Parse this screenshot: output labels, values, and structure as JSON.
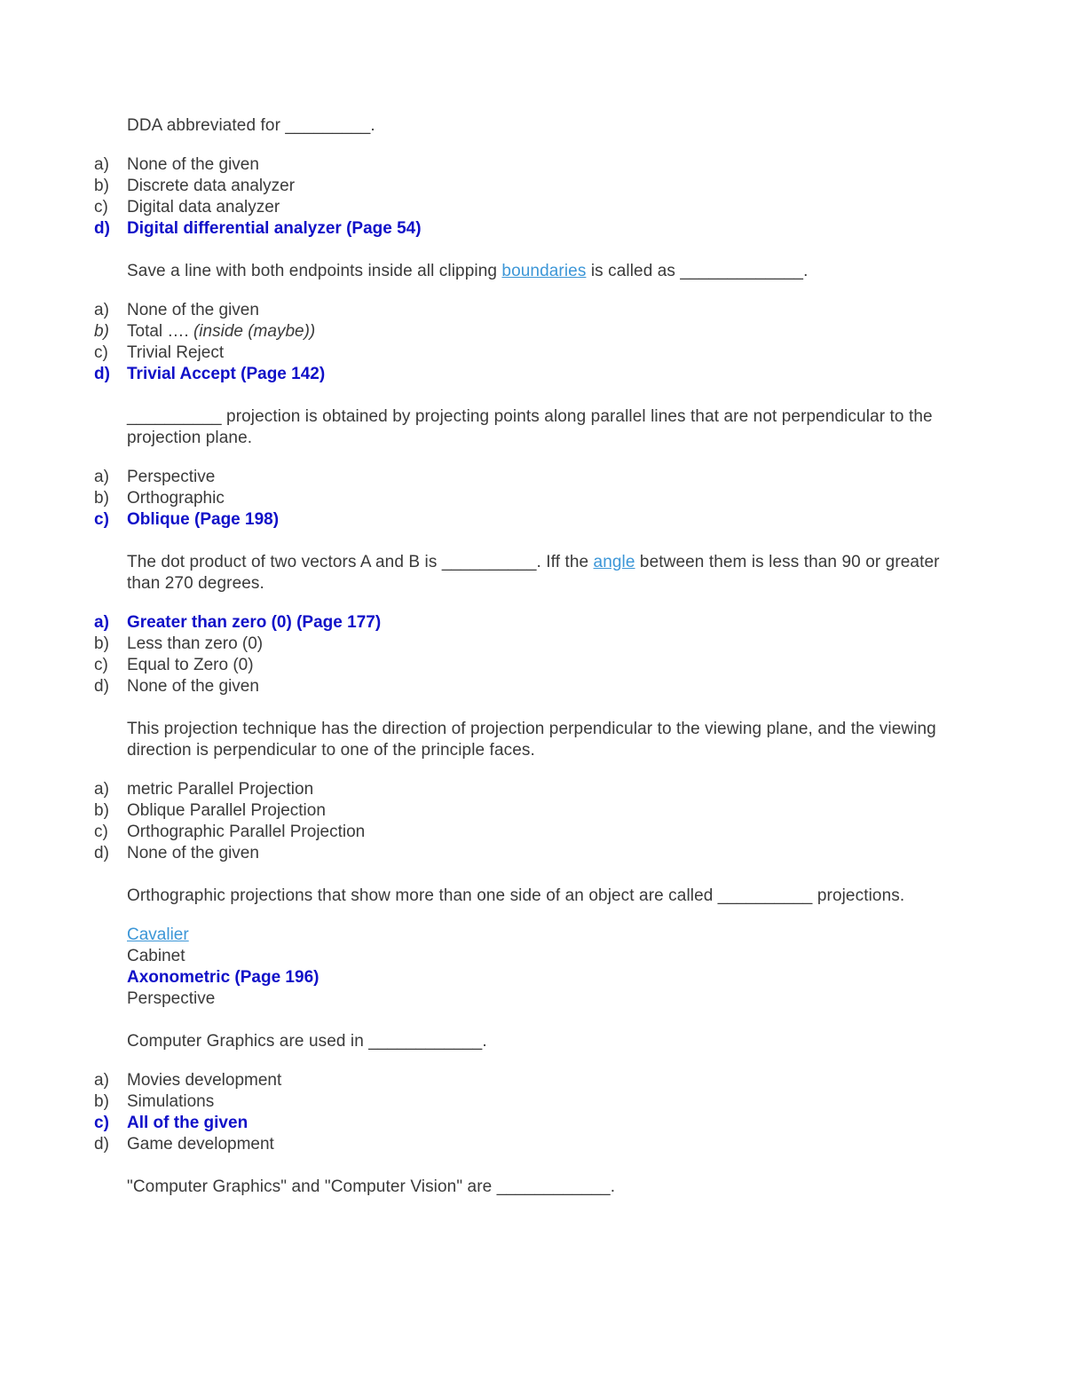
{
  "document": {
    "title": "Computer Graphics MCQs",
    "colors": {
      "body_text": "#3a3a3a",
      "correct_answer": "#1010c8",
      "hyperlink": "#3c96d7",
      "background": "#ffffff"
    }
  },
  "questions": [
    {
      "id": "q1",
      "stem_parts": [
        {
          "type": "text",
          "value": "DDA abbreviated for "
        },
        {
          "type": "blank",
          "value": "_________"
        },
        {
          "type": "text",
          "value": "."
        }
      ],
      "stem_plain": "DDA abbreviated for _________.",
      "labeled": true,
      "options": [
        {
          "label": "a)",
          "text": "None of the given",
          "correct": false,
          "italic": false
        },
        {
          "label": "b)",
          "text": "Discrete data analyzer",
          "correct": false,
          "italic": false
        },
        {
          "label": "c)",
          "text": "Digital data analyzer",
          "correct": false,
          "italic": false
        },
        {
          "label": "d)",
          "text": "Digital differential analyzer (Page 54)",
          "correct": true,
          "italic": false
        }
      ]
    },
    {
      "id": "q2",
      "stem_parts": [
        {
          "type": "text",
          "value": "Save a line with both endpoints inside all clipping "
        },
        {
          "type": "link",
          "value": "boundaries"
        },
        {
          "type": "text",
          "value": " is called as "
        },
        {
          "type": "blank",
          "value": "_____________"
        },
        {
          "type": "text",
          "value": "."
        }
      ],
      "stem_plain": "Save a line with both endpoints inside all clipping boundaries is called as _____________.",
      "labeled": true,
      "options": [
        {
          "label": "a)",
          "text": "None of the given",
          "correct": false,
          "italic": false
        },
        {
          "label": "b)",
          "text": "Total …. (inside (maybe))",
          "correct": false,
          "italic": true,
          "plain_prefix": "Total …. ",
          "italic_suffix": "(inside (maybe))"
        },
        {
          "label": "c)",
          "text": "Trivial Reject",
          "correct": false,
          "italic": false
        },
        {
          "label": "d)",
          "text": "Trivial Accept (Page 142)",
          "correct": true,
          "italic": false
        }
      ]
    },
    {
      "id": "q3",
      "stem_parts": [
        {
          "type": "blank",
          "value": "__________"
        },
        {
          "type": "text",
          "value": " projection is obtained by projecting points along parallel lines that are not perpendicular to the projection plane."
        }
      ],
      "stem_plain": "__________ projection is obtained by projecting points along parallel lines that are not perpendicular to the projection plane.",
      "labeled": true,
      "options": [
        {
          "label": "a)",
          "text": "Perspective",
          "correct": false,
          "italic": false
        },
        {
          "label": "b)",
          "text": "Orthographic",
          "correct": false,
          "italic": false
        },
        {
          "label": "c)",
          "text": "Oblique (Page 198)",
          "correct": true,
          "italic": false
        }
      ]
    },
    {
      "id": "q4",
      "stem_parts": [
        {
          "type": "text",
          "value": "The dot product of two vectors A and B is "
        },
        {
          "type": "blank",
          "value": "__________"
        },
        {
          "type": "text",
          "value": ". Iff the "
        },
        {
          "type": "link",
          "value": "angle"
        },
        {
          "type": "text",
          "value": " between them is less than 90 or greater than 270 degrees."
        }
      ],
      "stem_plain": "The dot product of two vectors A and B is __________. Iff the angle between them is less than 90 or greater than 270 degrees.",
      "labeled": true,
      "options": [
        {
          "label": "a)",
          "text": "Greater than zero (0) (Page 177)",
          "correct": true,
          "italic": false
        },
        {
          "label": "b)",
          "text": "Less than zero (0)",
          "correct": false,
          "italic": false
        },
        {
          "label": "c)",
          "text": "Equal to Zero (0)",
          "correct": false,
          "italic": false
        },
        {
          "label": "d)",
          "text": "None of the given",
          "correct": false,
          "italic": false
        }
      ]
    },
    {
      "id": "q5",
      "stem_parts": [
        {
          "type": "text",
          "value": "This projection technique has the direction of projection perpendicular to the viewing plane, and the viewing direction is perpendicular to one of the principle faces."
        }
      ],
      "stem_plain": "This projection technique has the direction of projection perpendicular to the viewing plane, and the viewing direction is perpendicular to one of the principle faces.",
      "labeled": true,
      "options": [
        {
          "label": "a)",
          "text": "metric Parallel Projection",
          "correct": false,
          "italic": false
        },
        {
          "label": "b)",
          "text": "Oblique Parallel Projection",
          "correct": false,
          "italic": false
        },
        {
          "label": "c)",
          "text": "Orthographic Parallel Projection",
          "correct": false,
          "italic": false
        },
        {
          "label": "d)",
          "text": "None of the given",
          "correct": false,
          "italic": false
        }
      ]
    },
    {
      "id": "q6",
      "stem_parts": [
        {
          "type": "text",
          "value": "Orthographic projections that show more than one side of an object are called "
        },
        {
          "type": "blank",
          "value": "__________"
        },
        {
          "type": "text",
          "value": " projections."
        }
      ],
      "stem_plain": "Orthographic projections that show more than one side of an object are called __________ projections.",
      "labeled": false,
      "options": [
        {
          "label": "",
          "text": "Cavalier",
          "correct": false,
          "italic": false,
          "link": true
        },
        {
          "label": "",
          "text": "Cabinet",
          "correct": false,
          "italic": false
        },
        {
          "label": "",
          "text": "Axonometric (Page 196)",
          "correct": true,
          "italic": false
        },
        {
          "label": "",
          "text": "Perspective",
          "correct": false,
          "italic": false
        }
      ]
    },
    {
      "id": "q7",
      "stem_parts": [
        {
          "type": "text",
          "value": "Computer Graphics are used in "
        },
        {
          "type": "blank",
          "value": "____________"
        },
        {
          "type": "text",
          "value": "."
        }
      ],
      "stem_plain": "Computer Graphics are used in ____________.",
      "labeled": true,
      "options": [
        {
          "label": "a)",
          "text": "Movies development",
          "correct": false,
          "italic": false
        },
        {
          "label": "b)",
          "text": "Simulations",
          "correct": false,
          "italic": false
        },
        {
          "label": "c)",
          "text": "All of the given",
          "correct": true,
          "italic": false
        },
        {
          "label": "d)",
          "text": "Game development",
          "correct": false,
          "italic": false
        }
      ]
    },
    {
      "id": "q8",
      "stem_parts": [
        {
          "type": "text",
          "value": "\"Computer Graphics\" and \"Computer Vision\" are "
        },
        {
          "type": "blank",
          "value": "____________"
        },
        {
          "type": "text",
          "value": "."
        }
      ],
      "stem_plain": "\"Computer Graphics\" and \"Computer Vision\" are ____________.",
      "labeled": true,
      "options": []
    }
  ]
}
